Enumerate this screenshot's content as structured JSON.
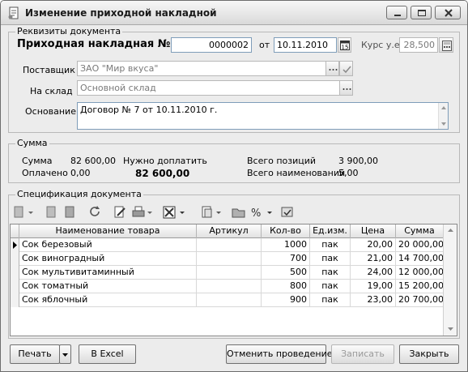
{
  "window": {
    "title": "Изменение приходной накладной"
  },
  "details": {
    "group_label": "Реквизиты документа",
    "doc_label": "Приходная накладная №",
    "doc_number": "0000002",
    "date_label": "от",
    "date_value": "10.11.2010",
    "calendar_label": "15",
    "rate_label": "Курс у.е.",
    "rate_value": "28,500",
    "supplier_label": "Поставщик",
    "supplier_value": "ЗАО \"Мир вкуса\"",
    "warehouse_label": "На склад",
    "warehouse_value": "Основной склад",
    "basis_label": "Основание",
    "basis_value": "Договор № 7 от 10.11.2010 г."
  },
  "sum": {
    "group_label": "Сумма",
    "sum_label": "Сумма",
    "sum_value": "82 600,00",
    "paid_label": "Оплачено",
    "paid_value": "0,00",
    "topay_label": "Нужно доплатить",
    "topay_value": "82 600,00",
    "positions_label": "Всего позиций",
    "positions_value": "3 900,00",
    "names_label": "Всего наименований",
    "names_value": "5,00"
  },
  "spec": {
    "group_label": "Спецификация документа",
    "columns": [
      "Наименование товара",
      "Артикул",
      "Кол-во",
      "Ед.изм.",
      "Цена",
      "Сумма"
    ],
    "rows": [
      [
        "Сок березовый",
        "",
        "1000",
        "пак",
        "20,00",
        "20 000,00"
      ],
      [
        "Сок виноградный",
        "",
        "700",
        "пак",
        "21,00",
        "14 700,00"
      ],
      [
        "Сок мультивитаминный",
        "",
        "500",
        "пак",
        "24,00",
        "12 000,00"
      ],
      [
        "Сок томатный",
        "",
        "800",
        "пак",
        "19,00",
        "15 200,00"
      ],
      [
        "Сок яблочный",
        "",
        "900",
        "пак",
        "23,00",
        "20 700,00"
      ]
    ]
  },
  "footer": {
    "print": "Печать",
    "excel": "В Excel",
    "cancel_posting": "Отменить проведение",
    "save": "Записать",
    "close": "Закрыть"
  }
}
